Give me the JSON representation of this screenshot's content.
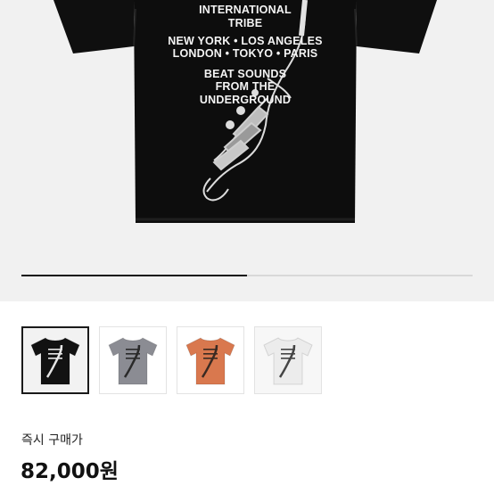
{
  "product": {
    "print_lines": [
      "INTERNATIONAL",
      "TRIBE",
      "NEW YORK • LOS ANGELES",
      "LONDON • TOKYO • PARIS",
      "BEAT SOUNDS",
      "FROM THE",
      "UNDERGROUND"
    ],
    "image_progress": 0.5,
    "thumbnails": [
      {
        "color_name": "black",
        "shirt_color": "#121212",
        "bg": "#f2f2f2",
        "print_color": "#e6e6e6",
        "selected": true
      },
      {
        "color_name": "grey",
        "shirt_color": "#8b8c93",
        "bg": "#ffffff",
        "print_color": "#2a2a2a",
        "selected": false
      },
      {
        "color_name": "orange",
        "shirt_color": "#d9784e",
        "bg": "#ffffff",
        "print_color": "#3a2a22",
        "selected": false
      },
      {
        "color_name": "white",
        "shirt_color": "#ececec",
        "bg": "#f7f7f7",
        "print_color": "#444444",
        "selected": false
      }
    ],
    "price_label": "즉시 구매가",
    "price": "82,000원"
  }
}
